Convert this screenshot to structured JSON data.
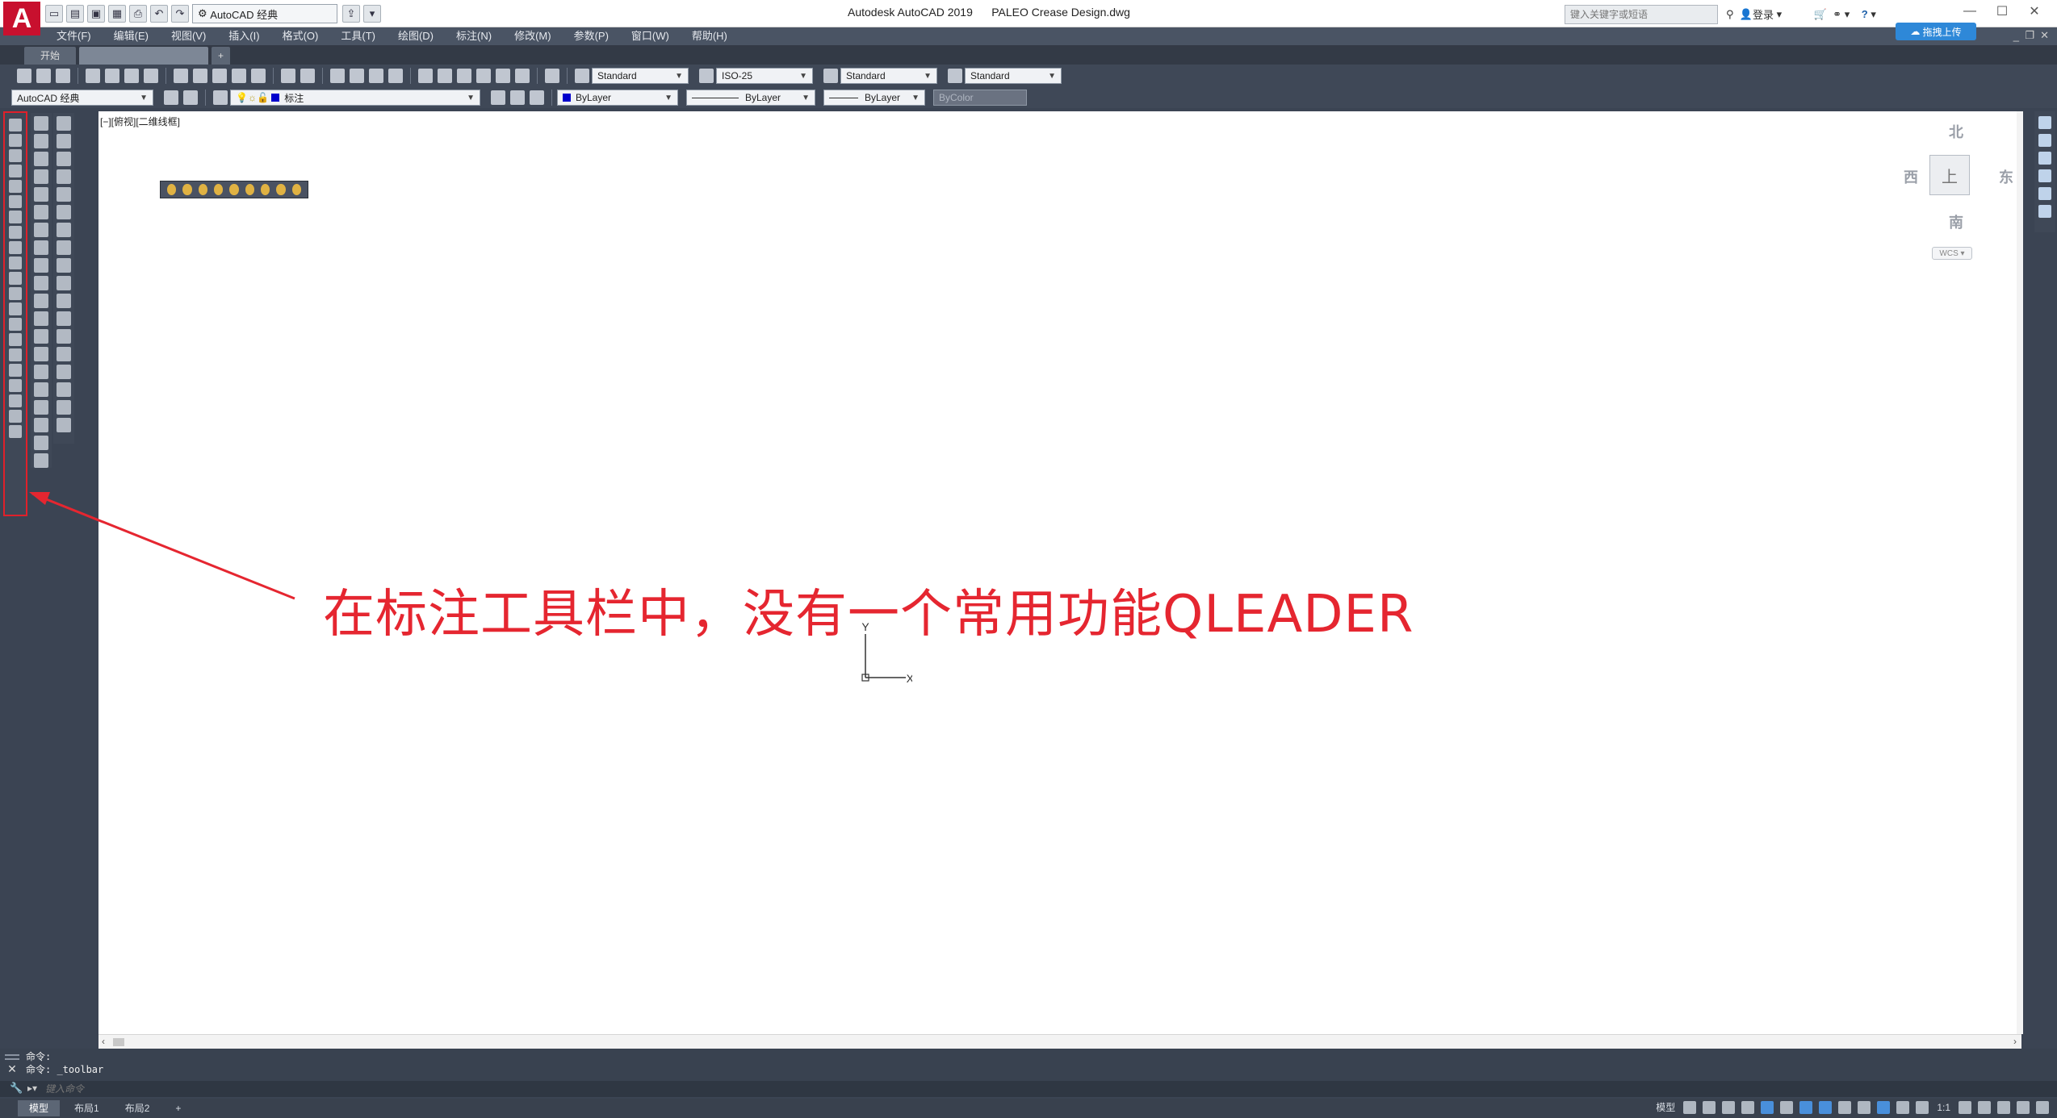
{
  "title_bar": {
    "app_title": "Autodesk AutoCAD 2019",
    "file_name": "PALEO Crease Design.dwg",
    "workspace": "AutoCAD 经典",
    "search_placeholder": "键入关键字或短语",
    "login_label": "登录",
    "help_label": "?",
    "upload_button": "拖拽上传",
    "minimize": "—",
    "maximize": "☐",
    "close": "✕",
    "logo": "A"
  },
  "menu": [
    "文件(F)",
    "编辑(E)",
    "视图(V)",
    "插入(I)",
    "格式(O)",
    "工具(T)",
    "绘图(D)",
    "标注(N)",
    "修改(M)",
    "参数(P)",
    "窗口(W)",
    "帮助(H)"
  ],
  "tabs": {
    "start": "开始",
    "new_tab": "+"
  },
  "toolbar1": {
    "text_style": "Standard",
    "dim_style": "ISO-25",
    "table_style": "Standard",
    "mleader_style": "Standard"
  },
  "toolbar2": {
    "workspace": "AutoCAD 经典",
    "layer": "标注",
    "color": "ByLayer",
    "linetype": "ByLayer",
    "lineweight": "ByLayer",
    "plot_style": "ByColor"
  },
  "canvas": {
    "view_label": "[−][俯视][二维线框]",
    "ucs_x": "X",
    "ucs_y": "Y"
  },
  "view_cube": {
    "north": "北",
    "south": "南",
    "east": "东",
    "west": "西",
    "face": "上",
    "wcs": "WCS"
  },
  "annotation": {
    "text": "在标注工具栏中，没有一个常用功能QLEADER",
    "color": "#e52630"
  },
  "command_line": {
    "history": [
      "命令:",
      "命令: _toolbar"
    ],
    "input_placeholder": "键入命令"
  },
  "status_bar": {
    "layout_tabs": [
      "模型",
      "布局1",
      "布局2"
    ],
    "add_layout": "+",
    "model_label": "模型",
    "scale": "1:1"
  }
}
